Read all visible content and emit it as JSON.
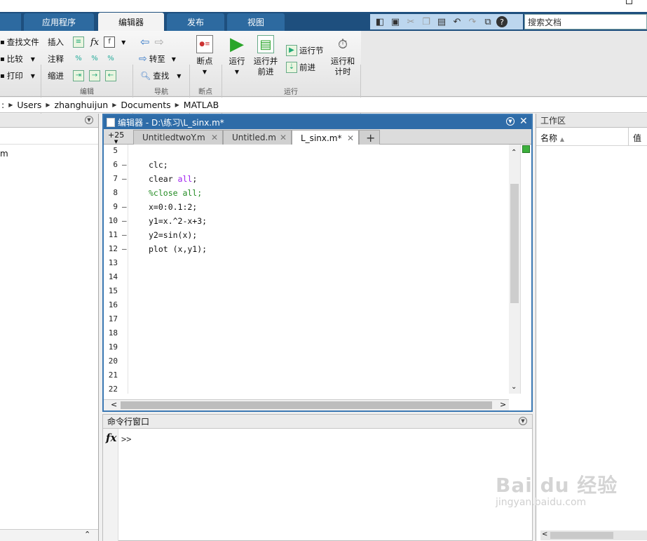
{
  "ribbon_tabs": [
    "应用程序",
    "编辑器",
    "发布",
    "视图"
  ],
  "search": {
    "placeholder": "搜索文档"
  },
  "toolbar": {
    "find_file": "查找文件",
    "compare": "比较",
    "print": "打印",
    "insert": "插入",
    "comment": "注释",
    "indent": "缩进",
    "goto": "转至",
    "find": "查找",
    "breakpoints": "断点",
    "run": "运行",
    "run_advance_1": "运行并",
    "run_advance_2": "前进",
    "run_section": "运行节",
    "advance": "前进",
    "run_time_1": "运行和",
    "run_time_2": "计时",
    "fx": "fx"
  },
  "groups": {
    "edit": "编辑",
    "navigate": "导航",
    "breakpoints": "断点",
    "run": "运行"
  },
  "address": {
    "root": ":",
    "crumbs": [
      "Users",
      "zhanghuijun",
      "Documents",
      "MATLAB"
    ]
  },
  "left_panel": {
    "file_fragment": "m"
  },
  "editor": {
    "title": "编辑器 - D:\\练习\\L_sinx.m*",
    "hidden_tabs": "+25",
    "tabs": [
      "UntitledtwoY.m",
      "Untitled.m",
      "L_sinx.m*"
    ],
    "add_tab": "+",
    "lines": [
      {
        "num": "5",
        "dash": "",
        "parts": []
      },
      {
        "num": "6",
        "dash": "–",
        "parts": [
          {
            "t": "clc;",
            "c": ""
          }
        ]
      },
      {
        "num": "7",
        "dash": "–",
        "parts": [
          {
            "t": "clear ",
            "c": ""
          },
          {
            "t": "all",
            "c": "kw"
          },
          {
            "t": ";",
            "c": ""
          }
        ]
      },
      {
        "num": "8",
        "dash": "",
        "parts": [
          {
            "t": "%close all;",
            "c": "cm"
          }
        ]
      },
      {
        "num": "9",
        "dash": "–",
        "parts": [
          {
            "t": "x=0:0.1:2;",
            "c": ""
          }
        ]
      },
      {
        "num": "10",
        "dash": "–",
        "parts": [
          {
            "t": "y1=x.^2-x+3;",
            "c": ""
          }
        ]
      },
      {
        "num": "11",
        "dash": "–",
        "parts": [
          {
            "t": "y2=sin(x);",
            "c": ""
          }
        ]
      },
      {
        "num": "12",
        "dash": "–",
        "parts": [
          {
            "t": "plot (x,y1);",
            "c": ""
          }
        ]
      },
      {
        "num": "13",
        "dash": "",
        "parts": []
      },
      {
        "num": "14",
        "dash": "",
        "parts": []
      },
      {
        "num": "15",
        "dash": "",
        "parts": []
      },
      {
        "num": "16",
        "dash": "",
        "parts": []
      },
      {
        "num": "17",
        "dash": "",
        "parts": []
      },
      {
        "num": "18",
        "dash": "",
        "parts": []
      },
      {
        "num": "19",
        "dash": "",
        "parts": []
      },
      {
        "num": "20",
        "dash": "",
        "parts": []
      },
      {
        "num": "21",
        "dash": "",
        "parts": []
      },
      {
        "num": "22",
        "dash": "",
        "parts": []
      }
    ]
  },
  "command_window": {
    "title": "命令行窗口",
    "fx": "fx",
    "prompt": ">>"
  },
  "workspace": {
    "title": "工作区",
    "col_name": "名称",
    "col_value": "值"
  },
  "watermark": {
    "brand": "Bai du 经验",
    "url": "jingyan.baidu.com"
  },
  "colors": {
    "ribbon_dark": "#1e4f7e",
    "editor_header": "#2e6ca8",
    "keyword": "#a020f0",
    "comment": "#228b22"
  }
}
